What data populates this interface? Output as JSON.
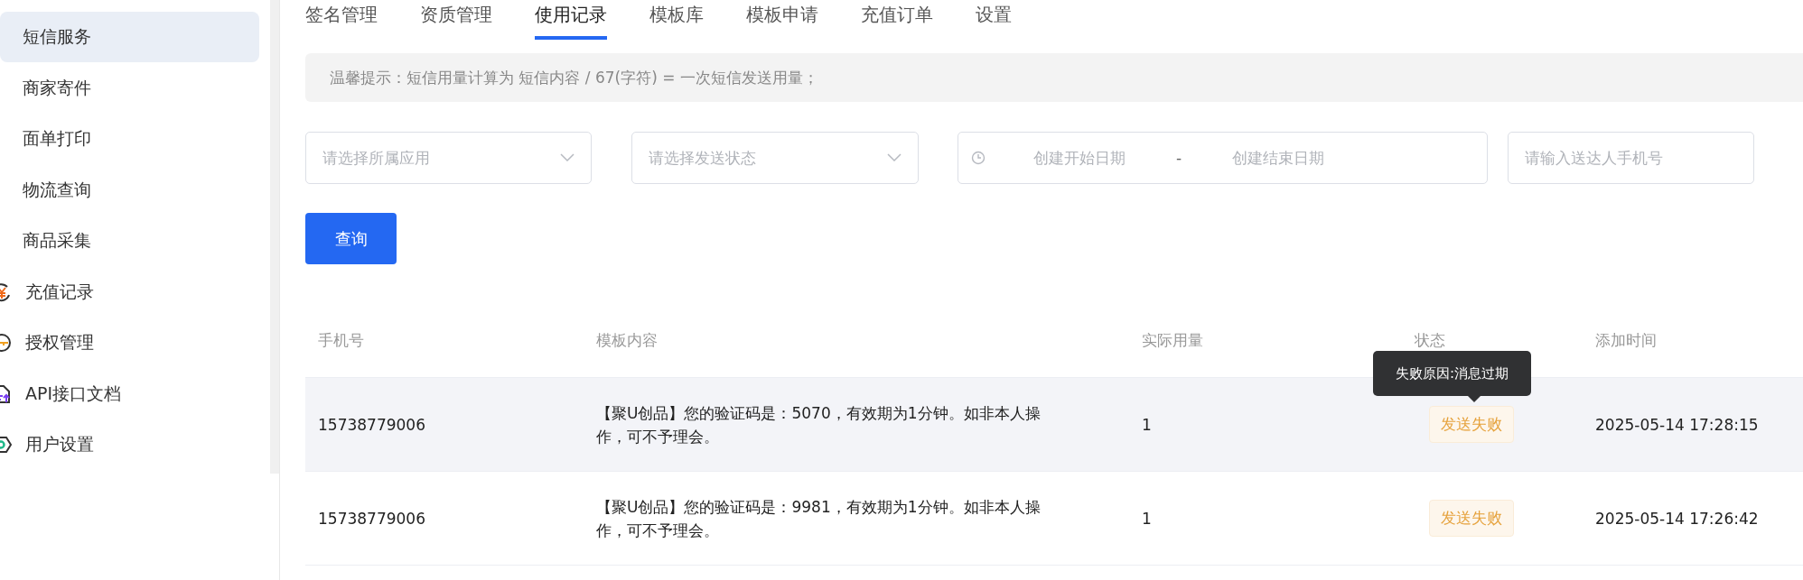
{
  "sidebar": {
    "items": [
      {
        "label": "短信服务",
        "selected": true,
        "kind": "text"
      },
      {
        "label": "商家寄件",
        "selected": false,
        "kind": "text"
      },
      {
        "label": "面单打印",
        "selected": false,
        "kind": "text"
      },
      {
        "label": "物流查询",
        "selected": false,
        "kind": "text"
      },
      {
        "label": "商品采集",
        "selected": false,
        "kind": "text"
      },
      {
        "label": "充值记录",
        "selected": false,
        "kind": "icon"
      },
      {
        "label": "授权管理",
        "selected": false,
        "kind": "icon"
      },
      {
        "label": "API接口文档",
        "selected": false,
        "kind": "icon"
      },
      {
        "label": "用户设置",
        "selected": false,
        "kind": "icon"
      }
    ]
  },
  "tabs": [
    {
      "label": "签名管理",
      "selected": false
    },
    {
      "label": "资质管理",
      "selected": false
    },
    {
      "label": "使用记录",
      "selected": true
    },
    {
      "label": "模板库",
      "selected": false
    },
    {
      "label": "模板申请",
      "selected": false
    },
    {
      "label": "充值订单",
      "selected": false
    },
    {
      "label": "设置",
      "selected": false
    }
  ],
  "notice": "温馨提示：短信用量计算为 短信内容 / 67(字符) = 一次短信发送用量；",
  "filters": {
    "app_select": {
      "placeholder": "请选择所属应用"
    },
    "status_select": {
      "placeholder": "请选择发送状态"
    },
    "date_range": {
      "start_placeholder": "创建开始日期",
      "separator": "-",
      "end_placeholder": "创建结束日期"
    },
    "phone_input": {
      "placeholder": "请输入送达人手机号"
    },
    "query_button": "查询"
  },
  "table": {
    "columns": [
      "手机号",
      "模板内容",
      "实际用量",
      "状态",
      "添加时间"
    ],
    "rows": [
      {
        "phone": "15738779006",
        "content": "【聚U创品】您的验证码是：5070，有效期为1分钟。如非本人操作，可不予理会。",
        "usage": "1",
        "status": "发送失败",
        "tooltip": "失败原因:消息过期",
        "time": "2025-05-14 17:28:15",
        "hovered": true
      },
      {
        "phone": "15738779006",
        "content": "【聚U创品】您的验证码是：9981，有效期为1分钟。如非本人操作，可不予理会。",
        "usage": "1",
        "status": "发送失败",
        "time": "2025-05-14 17:26:42",
        "hovered": false
      }
    ]
  }
}
